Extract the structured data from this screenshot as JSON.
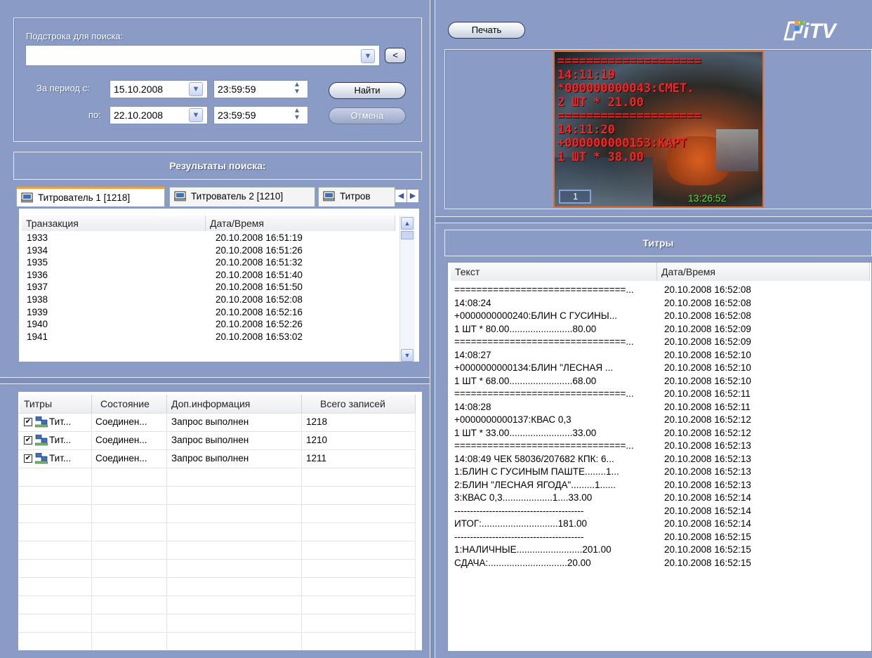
{
  "search": {
    "substring_label": "Подстрока для поиска:",
    "substring_value": "",
    "period_from_label": "За период с:",
    "period_to_label": "по:",
    "from_date": "15.10.2008",
    "from_time": "23:59:59",
    "to_date": "22.10.2008",
    "to_time": "23:59:59",
    "find_label": "Найти",
    "cancel_label": "Отмена",
    "back_glyph": "<"
  },
  "results": {
    "title": "Результаты поиска:",
    "tabs": [
      "Титрователь 1 [1218]",
      "Титрователь 2 [1210]",
      "Титров"
    ],
    "columns": [
      "Транзакция",
      "Дата/Время"
    ],
    "rows": [
      [
        "1933",
        "20.10.2008 16:51:19"
      ],
      [
        "1934",
        "20.10.2008 16:51:26"
      ],
      [
        "1935",
        "20.10.2008 16:51:32"
      ],
      [
        "1936",
        "20.10.2008 16:51:40"
      ],
      [
        "1937",
        "20.10.2008 16:51:50"
      ],
      [
        "1938",
        "20.10.2008 16:52:08"
      ],
      [
        "1939",
        "20.10.2008 16:52:16"
      ],
      [
        "1940",
        "20.10.2008 16:52:26"
      ],
      [
        "1941",
        "20.10.2008 16:53:02"
      ]
    ]
  },
  "sources": {
    "columns": [
      "Титры",
      "Состояние",
      "Доп.информация",
      "Всего записей"
    ],
    "rows": [
      [
        "Тит...",
        "Соединен...",
        "Запрос выполнен",
        "1218"
      ],
      [
        "Тит...",
        "Соединен...",
        "Запрос выполнен",
        "1210"
      ],
      [
        "Тит...",
        "Соединен...",
        "Запрос выполнен",
        "1211"
      ]
    ]
  },
  "viewer": {
    "print_label": "Печать",
    "logo_text": "iTV",
    "camera_number": "1",
    "timestamp": "13:26:52",
    "overlay_lines": [
      "====================",
      "14:11:19",
      "*000000000043:СМЕТ.",
      "2 ШТ * 21.00",
      "====================",
      "14:11:20",
      "+000000000153:КАРТ",
      "1 ШТ * 38.00"
    ]
  },
  "titles": {
    "title": "Титры",
    "columns": [
      "Текст",
      "Дата/Время"
    ],
    "rows": [
      [
        "===============================...",
        "20.10.2008 16:52:08"
      ],
      [
        "14:08:24",
        "20.10.2008 16:52:08"
      ],
      [
        "+0000000000240:БЛИН С ГУСИНЫ...",
        "20.10.2008 16:52:08"
      ],
      [
        "1 ШТ * 80.00........................80.00",
        "20.10.2008 16:52:09"
      ],
      [
        "===============================...",
        "20.10.2008 16:52:09"
      ],
      [
        "14:08:27",
        "20.10.2008 16:52:10"
      ],
      [
        "+0000000000134:БЛИН \"ЛЕСНАЯ ...",
        "20.10.2008 16:52:10"
      ],
      [
        "1 ШТ * 68.00........................68.00",
        "20.10.2008 16:52:10"
      ],
      [
        "===============================...",
        "20.10.2008 16:52:11"
      ],
      [
        "14:08:28",
        "20.10.2008 16:52:11"
      ],
      [
        "+0000000000137:КВАС 0,3",
        "20.10.2008 16:52:12"
      ],
      [
        "1 ШТ * 33.00........................33.00",
        "20.10.2008 16:52:12"
      ],
      [
        "===============================...",
        "20.10.2008 16:52:13"
      ],
      [
        "14:08:49  ЧЕК 58036/207682 КПК: 6...",
        "20.10.2008 16:52:13"
      ],
      [
        "1:БЛИН С ГУСИНЫМ ПАШТЕ........1...",
        "20.10.2008 16:52:13"
      ],
      [
        "2:БЛИН \"ЛЕСНАЯ ЯГОДА\".........1......",
        "20.10.2008 16:52:13"
      ],
      [
        "3:КВАС 0,3...................1....33.00",
        "20.10.2008 16:52:14"
      ],
      [
        "-----------------------------------------",
        "20.10.2008 16:52:14"
      ],
      [
        "ИТОГ:.............................181.00",
        "20.10.2008 16:52:14"
      ],
      [
        "-----------------------------------------",
        "20.10.2008 16:52:15"
      ],
      [
        "1:НАЛИЧНЫЕ.........................201.00",
        "20.10.2008 16:52:15"
      ],
      [
        "СДАЧА:..............................20.00",
        "20.10.2008 16:52:15"
      ]
    ]
  },
  "colors": {
    "background": "#8a9cc6",
    "accent": "#f0a040",
    "overlay_text": "#ff2020"
  }
}
